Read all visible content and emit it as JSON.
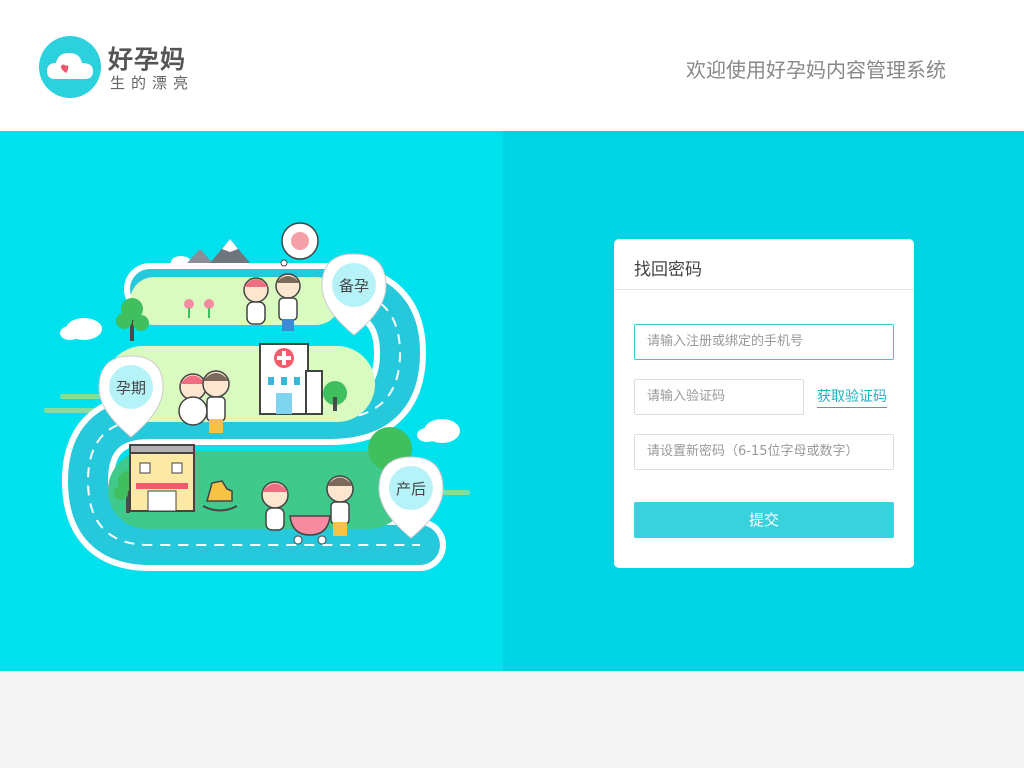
{
  "header": {
    "brand_name": "好孕妈",
    "brand_slogan": "生的漂亮",
    "welcome": "欢迎使用好孕妈内容管理系统"
  },
  "illustration": {
    "stage_prepare": "备孕",
    "stage_pregnancy": "孕期",
    "stage_postpartum": "产后"
  },
  "form": {
    "title": "找回密码",
    "phone_placeholder": "请输入注册或绑定的手机号",
    "code_placeholder": "请输入验证码",
    "get_code_label": "获取验证码",
    "password_placeholder": "请设置新密码（6-15位字母或数字）",
    "submit_label": "提交"
  },
  "colors": {
    "accent": "#39d2dc",
    "banner_left": "#00e1ee",
    "banner_right": "#00d3e2"
  }
}
